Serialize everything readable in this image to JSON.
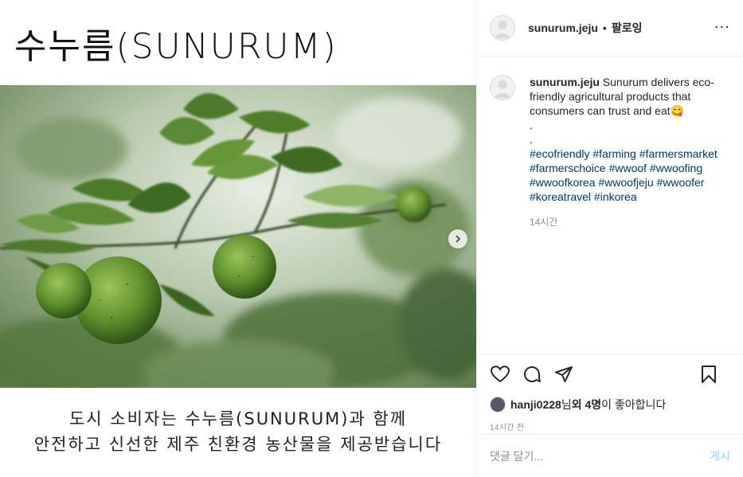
{
  "media": {
    "title": "수누름(SUNURUM)",
    "caption_line1": "도시 소비자는 수누름(SUNURUM)과 함께",
    "caption_line2": "안전하고 신선한 제주 친환경 농산물을 제공받습니다"
  },
  "header": {
    "username": "sunurum.jeju",
    "separator": "•",
    "follow_label": "팔로잉",
    "more_label": "···"
  },
  "post": {
    "username": "sunurum.jeju",
    "text": "Sunurum delivers eco-friendly agricultural products that consumers can trust and eat😋",
    "dot1": ".",
    "dot2": ".",
    "hashtags": "#ecofriendly #farming #farmersmarket #farmerschoice #wwoof #wwoofing #wwoofkorea #wwoofjeju #wwoofer #koreatravel #inkorea",
    "time": "14시간"
  },
  "likes": {
    "user": "hanji0228",
    "mid": "님 ",
    "others": "외 4명",
    "suffix": "이 좋아합니다"
  },
  "post_time": "14시간 전",
  "comment_box": {
    "placeholder": "댓글 달기...",
    "post_label": "게시"
  },
  "icons": [
    "heart-icon",
    "comment-icon",
    "share-icon",
    "bookmark-icon",
    "chevron-right-icon",
    "avatar-placeholder-icon"
  ]
}
